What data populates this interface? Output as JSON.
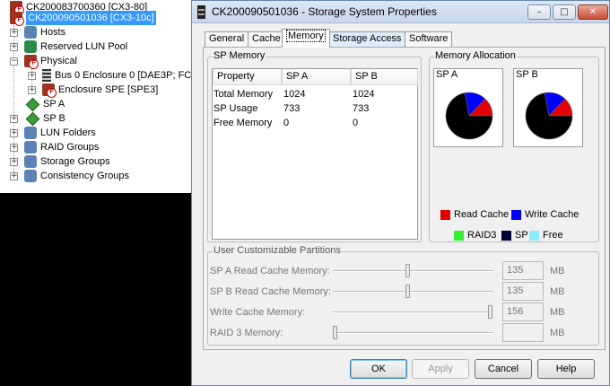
{
  "tree": {
    "nodes": [
      {
        "label": "CK200083700360 [CX3-80]",
        "icon": "server-icon",
        "selected": false
      },
      {
        "label": "CK200090501036 [CX3-10c]",
        "icon": "server-icon",
        "selected": true
      },
      {
        "label": "Hosts",
        "icon": "hosts-icon"
      },
      {
        "label": "Reserved LUN Pool",
        "icon": "lun-pool-icon"
      },
      {
        "label": "Physical",
        "icon": "physical-icon"
      },
      {
        "label": "Bus 0 Enclosure 0 [DAE3P; FC;",
        "icon": "enclosure-icon"
      },
      {
        "label": "Enclosure SPE [SPE3]",
        "icon": "enclosure-spe-icon"
      },
      {
        "label": "SP A",
        "icon": "sp-diamond-icon"
      },
      {
        "label": "SP B",
        "icon": "sp-diamond-icon"
      },
      {
        "label": "LUN Folders",
        "icon": "folder-icon"
      },
      {
        "label": "RAID Groups",
        "icon": "raid-icon"
      },
      {
        "label": "Storage Groups",
        "icon": "storage-icon"
      },
      {
        "label": "Consistency Groups",
        "icon": "consistency-icon"
      }
    ]
  },
  "dialog": {
    "title": "CK200090501036 - Storage System Properties",
    "window_buttons": {
      "minimize": "–",
      "maximize": "□",
      "close": "✕"
    },
    "tabs": [
      "General",
      "Cache",
      "Memory",
      "Storage Access",
      "Software"
    ],
    "active_tab": "Memory",
    "sp_memory": {
      "label": "SP Memory",
      "columns": [
        "Property",
        "SP A",
        "SP B"
      ],
      "rows": [
        [
          "Total Memory",
          "1024",
          "1024"
        ],
        [
          "SP Usage",
          "733",
          "733"
        ],
        [
          "Free Memory",
          "0",
          "0"
        ]
      ]
    },
    "allocation": {
      "label": "Memory Allocation",
      "pies": [
        {
          "label": "SP A",
          "slices": {
            "read_cache": 0.13,
            "write_cache": 0.15,
            "raid3": 0,
            "sp": 0.72,
            "free": 0
          }
        },
        {
          "label": "SP B",
          "slices": {
            "read_cache": 0.13,
            "write_cache": 0.15,
            "raid3": 0,
            "sp": 0.72,
            "free": 0
          }
        }
      ],
      "legend": [
        {
          "label": "Read Cache",
          "color": "#e00000"
        },
        {
          "label": "Write Cache",
          "color": "#0000ff"
        },
        {
          "label": "RAID3",
          "color": "#33ee33"
        },
        {
          "label": "SP",
          "color": "#000033"
        },
        {
          "label": "Free",
          "color": "#88eeff"
        }
      ]
    },
    "partitions": {
      "label": "User Customizable Partitions",
      "unit": "MB",
      "sliders": [
        {
          "label": "SP A Read Cache Memory:",
          "value": "135",
          "level": 0.47
        },
        {
          "label": "SP B Read Cache Memory:",
          "value": "135",
          "level": 0.47
        },
        {
          "label": "Write Cache Memory:",
          "value": "156",
          "level": 1.0
        },
        {
          "label": "RAID 3 Memory:",
          "value": "",
          "level": 0.0
        }
      ]
    },
    "buttons": {
      "ok": "OK",
      "apply": "Apply",
      "cancel": "Cancel",
      "help": "Help"
    }
  }
}
